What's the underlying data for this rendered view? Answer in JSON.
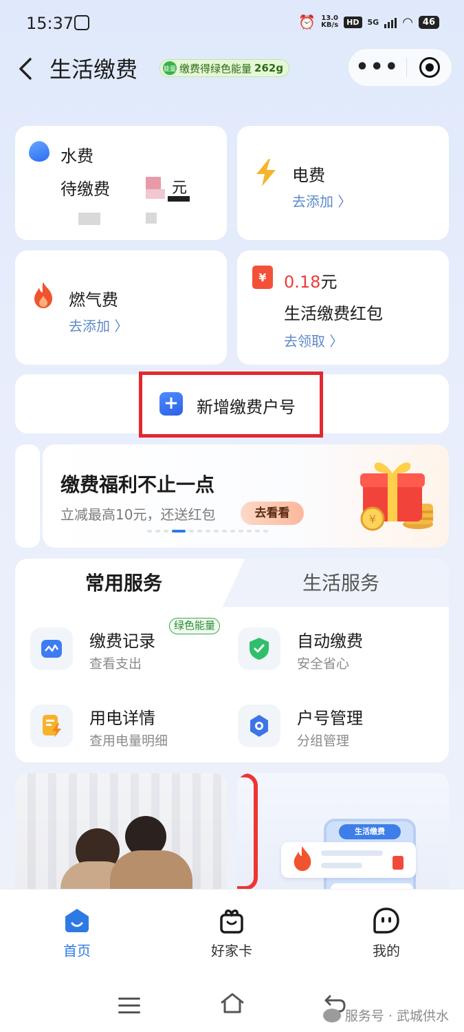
{
  "status_bar": {
    "time": "15:37",
    "speed_top": "13.0",
    "speed_bottom": "KB/s",
    "hd": "HD",
    "net": "5G",
    "battery": "46"
  },
  "header": {
    "title": "生活缴费",
    "energy_label": "缴费得绿色能量",
    "energy_value": "262g",
    "energy_badge": "能量"
  },
  "cards": {
    "water": {
      "name": "水费",
      "status": "待缴费",
      "unit": "元"
    },
    "electric": {
      "name": "电费",
      "action": "去添加 〉"
    },
    "gas": {
      "name": "燃气费",
      "action": "去添加 〉"
    },
    "redpacket": {
      "amount": "0.18",
      "unit": "元",
      "name": "生活缴费红包",
      "action": "去领取 〉",
      "icon_text": "¥"
    }
  },
  "add_account": {
    "label": "新增缴费户号"
  },
  "banner": {
    "title": "缴费福利不止一点",
    "subtitle": "立减最高10元，还送红包",
    "button": "去看看",
    "pages": 14,
    "active_page": 3
  },
  "services": {
    "tabs": [
      "常用服务",
      "生活服务"
    ],
    "items": [
      {
        "title": "缴费记录",
        "subtitle": "查看支出",
        "tag": "绿色能量",
        "icon": "chart-icon"
      },
      {
        "title": "自动缴费",
        "subtitle": "安全省心",
        "icon": "shield-check-icon"
      },
      {
        "title": "用电详情",
        "subtitle": "查用电量明细",
        "icon": "bill-bolt-icon"
      },
      {
        "title": "户号管理",
        "subtitle": "分组管理",
        "icon": "gear-icon"
      }
    ]
  },
  "promo": {
    "phone_title": "生活缴费"
  },
  "tabbar": {
    "items": [
      {
        "label": "首页",
        "active": true
      },
      {
        "label": "好家卡"
      },
      {
        "label": "我的"
      }
    ]
  },
  "watermark": {
    "text": "服务号 · 武城供水"
  },
  "colors": {
    "accent": "#2d7ae5",
    "highlight": "#e2272f",
    "link": "#5d88c9"
  }
}
